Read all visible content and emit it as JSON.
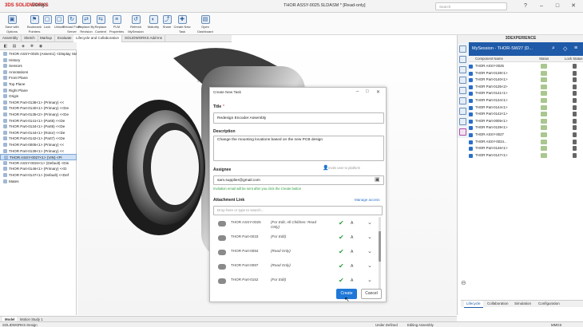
{
  "titlebar": {
    "logo": "3DS SOLIDWORKS",
    "logo_sub": "Design",
    "document_title": "THOR ASSY-0025.SLDASM * [Read-only]",
    "search_placeholder": "Search",
    "window_buttons": [
      "?",
      "–",
      "□",
      "✕"
    ]
  },
  "ribbon": {
    "buttons": [
      {
        "label": "Save with Options",
        "icon": "save-icon"
      },
      {
        "label": "Bookmark Pointers",
        "icon": "bookmark-icon"
      },
      {
        "label": "Lock",
        "icon": "lock-icon"
      },
      {
        "label": "Unlock",
        "icon": "unlock-icon"
      },
      {
        "label": "Reload From Server",
        "icon": "reload-icon"
      },
      {
        "label": "Replace By Revision",
        "icon": "replace-icon"
      },
      {
        "label": "Replace Content",
        "icon": "replace-content-icon"
      },
      {
        "label": "PLM Properties",
        "icon": "properties-icon"
      },
      {
        "label": "Refresh MySession",
        "icon": "refresh-icon"
      },
      {
        "label": "Maturity",
        "icon": "maturity-icon"
      },
      {
        "label": "Share",
        "icon": "share-icon"
      },
      {
        "label": "Create New Task",
        "icon": "task-icon"
      },
      {
        "label": "Open Dashboard",
        "icon": "dashboard-icon"
      }
    ]
  },
  "command_tabs": [
    "Assembly",
    "Sketch",
    "Markup",
    "Evaluate",
    "Lifecycle and Collaboration",
    "SOLIDWORKS Add-Ins"
  ],
  "active_command_tab": "Lifecycle and Collaboration",
  "feature_tree": {
    "rows": [
      {
        "label": "THOR ASSY-0025 (Assem1) <Display Stat"
      },
      {
        "label": "History"
      },
      {
        "label": "Sensors"
      },
      {
        "label": "Annotations"
      },
      {
        "label": "Front Plane"
      },
      {
        "label": "Top Plane"
      },
      {
        "label": "Right Plane"
      },
      {
        "label": "Origin"
      },
      {
        "label": "THOR Part-0138<1> (Primary) <<"
      },
      {
        "label": "THOR Part-0140<1> (Primary) <<De"
      },
      {
        "label": "THOR Part-0135<2> (Primary) <<De"
      },
      {
        "label": "THOR Part-0141<1> (Part6) <<De"
      },
      {
        "label": "THOR Part-0134<1> (Part6) <<De"
      },
      {
        "label": "THOR Part-0144<1> (Rotor) <<De"
      },
      {
        "label": "THOR Part-0142<1> (Part7) <<De"
      },
      {
        "label": "THOR Part-0005<1> (Primary) <<"
      },
      {
        "label": "THOR Part-0139<1> (Primary) <<"
      },
      {
        "label": "THOR ASSY-0027<1> (VIN) <Pi"
      },
      {
        "label": "THOR ASSY-0024<1> (Default) <Dis"
      },
      {
        "label": "THOR Part-0146<1> (Primary) <<D"
      },
      {
        "label": "THOR Part-0147<1> (Default) <<Def"
      },
      {
        "label": "Mates"
      }
    ],
    "selected_index": 17
  },
  "dialog": {
    "window_title": "Create New Task",
    "title_label": "Title",
    "title_required": "*",
    "title_value": "Redesign Encoder Assembly",
    "description_label": "Description",
    "description_value": "Change the mounting locations based on the new PCB design",
    "assignee_label": "Assignee",
    "invite_text": "Invite user to platform",
    "assignee_value": "sam.supplier@gmail.com",
    "hint_text": "Invitation email will be sent after you click the Create button",
    "attachment_label": "Attachment Link",
    "manage_access": "Manage access",
    "attach_search_placeholder": "Drop here or type to search...",
    "attachments": [
      {
        "name": "THOR ASSY-0025",
        "permission": "(For Edit, All Children: Read Only)",
        "level": "A"
      },
      {
        "name": "THOR Part-0033",
        "permission": "(For Edit)",
        "level": "A"
      },
      {
        "name": "THOR Part-0084",
        "permission": "(Read Only)",
        "level": "A"
      },
      {
        "name": "THOR Part-0087",
        "permission": "(Read Only)",
        "level": "A"
      },
      {
        "name": "THOR Part-0152",
        "permission": "(For Edit)",
        "level": "A"
      }
    ],
    "create_label": "Create",
    "cancel_label": "Cancel"
  },
  "right_panel": {
    "header": "3DEXPERIENCE",
    "session_label": "MySession - THOR-SW27 (D...",
    "columns": [
      "Component Name",
      "Status",
      "Lock Status"
    ],
    "rows": [
      "THOR ASSY-0025",
      "THOR Part-0138<1>",
      "THOR Part-0140<1>",
      "THOR Part-0135<2>",
      "THOR Part-0141<1>",
      "THOR Part-0134<1>",
      "THOR Part-0144<1>",
      "THOR Part-0142<1>",
      "THOR Part-0005<1>",
      "THOR Part-0139<1>",
      "THOR ASSY-0027",
      "THOR ASSY-0024...",
      "THOR Part-0146<1>",
      "THOR Part-0147<1>"
    ],
    "bottom_tabs": [
      "Lifecycle",
      "Collaboration",
      "Simulation",
      "Configuration"
    ],
    "active_tab": "Lifecycle"
  },
  "bottom_tabs": [
    "Model",
    "Motion Study 1"
  ],
  "active_bottom_tab": "Model",
  "status_bar": {
    "left": "SOLIDWORKS Design",
    "middle_1": "Under Defined",
    "middle_2": "Editing Assembly",
    "right": "MMGS"
  },
  "colors": {
    "accent": "#1e5aa8",
    "create_button": "#1e78d8",
    "check_green": "#2e9e40",
    "selection": "#cfe0f5"
  }
}
